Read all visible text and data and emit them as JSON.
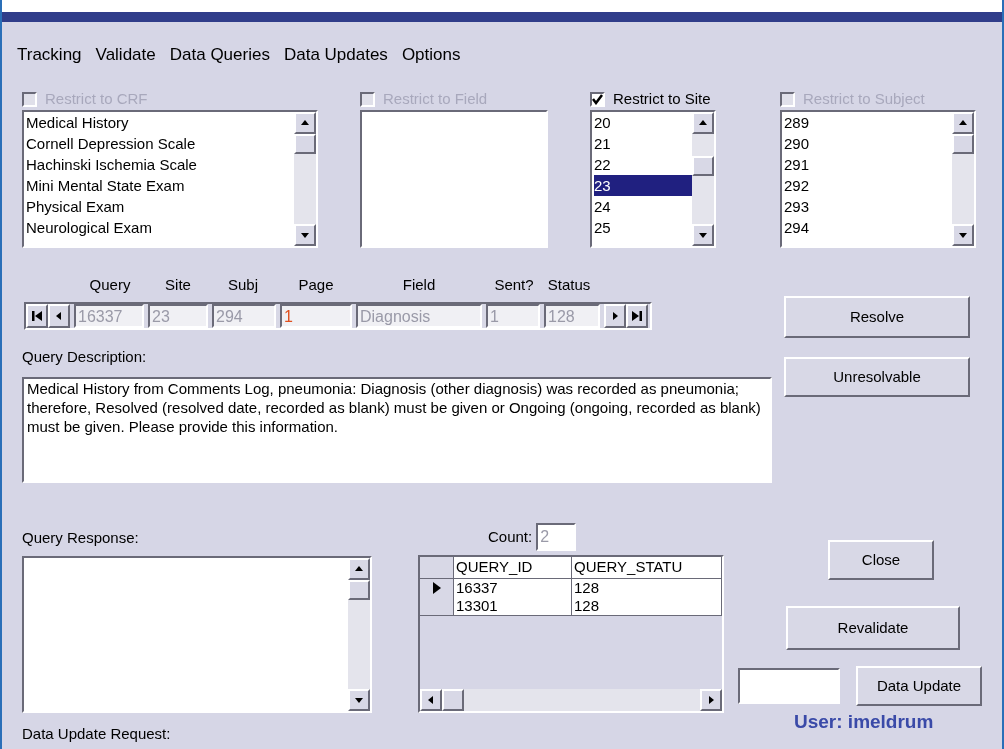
{
  "menu": [
    "Tracking",
    "Validate",
    "Data Queries",
    "Data Updates",
    "Options"
  ],
  "filters": [
    {
      "label": "Restrict to CRF",
      "checked": false,
      "disabled": true,
      "items": [
        {
          "text": "Medical History",
          "selected": false
        },
        {
          "text": "Cornell Depression Scale",
          "selected": false
        },
        {
          "text": "Hachinski Ischemia Scale",
          "selected": false
        },
        {
          "text": "Mini Mental State Exam",
          "selected": false
        },
        {
          "text": "Physical Exam",
          "selected": false
        },
        {
          "text": "Neurological Exam",
          "selected": false
        }
      ]
    },
    {
      "label": "Restrict to Field",
      "checked": false,
      "disabled": true
    },
    {
      "label": "Restrict to Site",
      "checked": true,
      "disabled": false,
      "items": [
        {
          "text": "20",
          "selected": false
        },
        {
          "text": "21",
          "selected": false
        },
        {
          "text": "22",
          "selected": false
        },
        {
          "text": "23",
          "selected": true
        },
        {
          "text": "24",
          "selected": false
        },
        {
          "text": "25",
          "selected": false
        }
      ]
    },
    {
      "label": "Restrict to Subject",
      "checked": false,
      "disabled": true,
      "items": [
        {
          "text": "289",
          "selected": false
        },
        {
          "text": "290",
          "selected": false
        },
        {
          "text": "291",
          "selected": false
        },
        {
          "text": "292",
          "selected": false
        },
        {
          "text": "293",
          "selected": false
        },
        {
          "text": "294",
          "selected": false
        }
      ]
    }
  ],
  "navigator": {
    "fields": [
      {
        "label": "Query",
        "value": "16337",
        "color": "#9a9aa8"
      },
      {
        "label": "Site",
        "value": "23",
        "color": "#9a9aa8"
      },
      {
        "label": "Subj",
        "value": "294",
        "color": "#9a9aa8"
      },
      {
        "label": "Page",
        "value": "1",
        "color": "#e0501e"
      },
      {
        "label": "Field",
        "value": "Diagnosis",
        "color": "#9a9aa8"
      },
      {
        "label": "Sent?",
        "value": "1",
        "color": "#9a9aa8"
      },
      {
        "label": "Status",
        "value": "128",
        "color": "#9a9aa8"
      }
    ]
  },
  "description": {
    "label": "Query Description:",
    "value": "Medical History from Comments Log, pneumonia: Diagnosis (other diagnosis) was recorded as pneumonia; therefore, Resolved (resolved date, recorded as blank) must be given or Ongoing (ongoing, recorded as blank) must be given.  Please provide this information."
  },
  "response": {
    "label": "Query Response:"
  },
  "count": {
    "label": "Count:",
    "value": "2"
  },
  "grid": {
    "columns": [
      "QUERY_ID",
      "QUERY_STATU"
    ],
    "rows": [
      {
        "cells": [
          "16337",
          "128"
        ],
        "selected": true
      },
      {
        "cells": [
          "13301",
          "128"
        ],
        "selected": false
      }
    ]
  },
  "buttons": {
    "resolve": "Resolve",
    "unresolvable": "Unresolvable",
    "close": "Close",
    "revalidate": "Revalidate",
    "data_update": "Data Update"
  },
  "user": "User: imeldrum",
  "data_update_request": {
    "label": "Data Update Request:"
  }
}
